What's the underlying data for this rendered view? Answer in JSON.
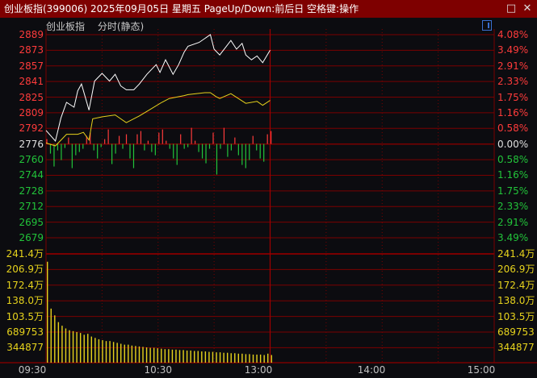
{
  "window": {
    "title": "创业板指(399006) 2025年09月05日 星期五 PageUp/Down:前后日 空格键:操作",
    "maximize_icon": "square-icon",
    "close_icon": "x-icon"
  },
  "header": {
    "name": "创业板指",
    "mode": "分时(静态)"
  },
  "colors": {
    "up": "#ff3b3b",
    "down": "#22c43a",
    "flat": "#e0e0e0",
    "volume": "#e6d21c",
    "grid": "#7a0000",
    "price_line": "#ffffff",
    "avg_line": "#e6d21c"
  },
  "price_axis": {
    "left": [
      "2889",
      "2873",
      "2857",
      "2841",
      "2825",
      "2809",
      "2792",
      "2776",
      "2760",
      "2744",
      "2728",
      "2712",
      "2695",
      "2679"
    ],
    "right": [
      "4.08%",
      "3.49%",
      "2.91%",
      "2.33%",
      "1.75%",
      "1.16%",
      "0.58%",
      "0.00%",
      "0.58%",
      "1.16%",
      "1.75%",
      "2.33%",
      "2.91%",
      "3.49%"
    ]
  },
  "volume_axis": {
    "left": [
      "241.4万",
      "206.9万",
      "172.4万",
      "138.0万",
      "103.5万",
      "689753",
      "344877"
    ],
    "right": [
      "241.4万",
      "206.9万",
      "172.4万",
      "138.0万",
      "103.5万",
      "689753",
      "344877"
    ]
  },
  "time_axis": [
    "09:30",
    "10:30",
    "13:00",
    "14:00",
    "15:00"
  ],
  "chart_data": {
    "type": "line",
    "prev_close": 2776,
    "ylim": [
      2679,
      2889
    ],
    "volume_ylim": [
      0,
      241.4
    ],
    "x_unit": "minutes since 09:30 (trading time)",
    "price": [
      [
        0,
        2790
      ],
      [
        5,
        2779
      ],
      [
        8,
        2803
      ],
      [
        11,
        2819
      ],
      [
        15,
        2814
      ],
      [
        17,
        2831
      ],
      [
        19,
        2838
      ],
      [
        23,
        2811
      ],
      [
        26,
        2841
      ],
      [
        30,
        2849
      ],
      [
        34,
        2841
      ],
      [
        37,
        2848
      ],
      [
        40,
        2836
      ],
      [
        43,
        2832
      ],
      [
        47,
        2832
      ],
      [
        50,
        2838
      ],
      [
        54,
        2848
      ],
      [
        59,
        2858
      ],
      [
        61,
        2850
      ],
      [
        64,
        2863
      ],
      [
        68,
        2848
      ],
      [
        71,
        2858
      ],
      [
        74,
        2871
      ],
      [
        76,
        2877
      ],
      [
        82,
        2881
      ],
      [
        88,
        2889
      ],
      [
        90,
        2874
      ],
      [
        93,
        2868
      ],
      [
        99,
        2883
      ],
      [
        102,
        2874
      ],
      [
        105,
        2880
      ],
      [
        107,
        2868
      ],
      [
        110,
        2863
      ],
      [
        113,
        2867
      ],
      [
        116,
        2860
      ],
      [
        120,
        2873
      ]
    ],
    "avg_price": [
      [
        0,
        2777
      ],
      [
        5,
        2774
      ],
      [
        11,
        2786
      ],
      [
        17,
        2786
      ],
      [
        20,
        2788
      ],
      [
        23,
        2780
      ],
      [
        25,
        2802
      ],
      [
        30,
        2804
      ],
      [
        37,
        2806
      ],
      [
        43,
        2798
      ],
      [
        50,
        2805
      ],
      [
        56,
        2812
      ],
      [
        62,
        2819
      ],
      [
        66,
        2823
      ],
      [
        74,
        2826
      ],
      [
        76,
        2827
      ],
      [
        85,
        2829
      ],
      [
        88,
        2829
      ],
      [
        91,
        2825
      ],
      [
        93,
        2823
      ],
      [
        99,
        2828
      ],
      [
        107,
        2818
      ],
      [
        113,
        2820
      ],
      [
        116,
        2816
      ],
      [
        120,
        2821
      ]
    ],
    "strength": [
      6,
      -12,
      -28,
      -8,
      -20,
      -5,
      8,
      -30,
      -14,
      -10,
      -6,
      10,
      14,
      -8,
      -18,
      -4,
      6,
      18,
      -25,
      -12,
      10,
      -6,
      12,
      -18,
      -30,
      12,
      16,
      -8,
      4,
      -10,
      -14,
      14,
      18,
      4,
      -6,
      -18,
      -26,
      12,
      -6,
      -4,
      20,
      4,
      -10,
      -18,
      -24,
      -6,
      14,
      -38,
      -6,
      20,
      -16,
      -8,
      8,
      -14,
      -26,
      -30,
      -20,
      10,
      -8,
      -18,
      -22,
      12,
      16
    ],
    "volume": [
      224,
      120,
      105,
      90,
      82,
      76,
      72,
      70,
      68,
      66,
      62,
      64,
      58,
      55,
      52,
      50,
      48,
      48,
      46,
      44,
      42,
      40,
      40,
      38,
      37,
      36,
      35,
      34,
      33,
      33,
      32,
      31,
      30,
      30,
      29,
      29,
      28,
      28,
      27,
      27,
      26,
      26,
      25,
      25,
      24,
      24,
      23,
      23,
      22,
      22,
      21,
      21,
      20,
      20,
      19,
      19,
      18,
      18,
      18,
      17,
      20,
      17
    ]
  }
}
